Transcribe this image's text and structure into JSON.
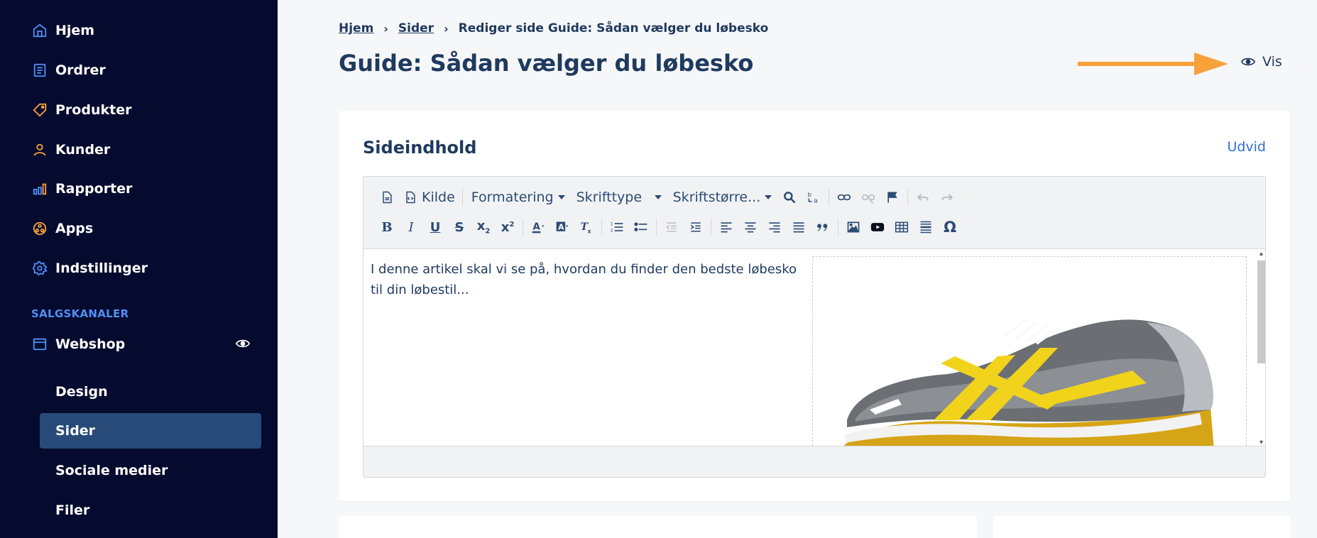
{
  "sidebar": {
    "items": [
      {
        "label": "Hjem",
        "icon": "home-icon"
      },
      {
        "label": "Ordrer",
        "icon": "orders-icon"
      },
      {
        "label": "Produkter",
        "icon": "tag-icon"
      },
      {
        "label": "Kunder",
        "icon": "user-icon"
      },
      {
        "label": "Rapporter",
        "icon": "chart-icon"
      },
      {
        "label": "Apps",
        "icon": "apps-icon"
      },
      {
        "label": "Indstillinger",
        "icon": "gear-icon"
      }
    ],
    "section_label": "SALGSKANALER",
    "channel": {
      "label": "Webshop",
      "icon": "store-icon"
    },
    "sub_items": [
      {
        "label": "Design"
      },
      {
        "label": "Sider"
      },
      {
        "label": "Sociale medier"
      },
      {
        "label": "Filer"
      }
    ],
    "active_sub": "Sider"
  },
  "breadcrumb": {
    "home": "Hjem",
    "pages": "Sider",
    "current": "Rediger side Guide: Sådan vælger du løbesko"
  },
  "page": {
    "title": "Guide: Sådan vælger du løbesko",
    "view_label": "Vis"
  },
  "card": {
    "title": "Sideindhold",
    "expand_label": "Udvid"
  },
  "editor": {
    "source_label": "Kilde",
    "format_label": "Formatering",
    "font_label": "Skrifttype",
    "size_label": "Skriftstørre...",
    "content": "I denne artikel skal vi se på, hvordan du finder den bedste løbesko til din løbestil...",
    "image_icon": "running-shoe-image"
  },
  "colors": {
    "sidebar_bg": "#050b2e",
    "active_bg": "#274a78",
    "accent_blue": "#4f8ff7",
    "arrow_orange": "#f7a139",
    "text": "#1f3a5f"
  }
}
